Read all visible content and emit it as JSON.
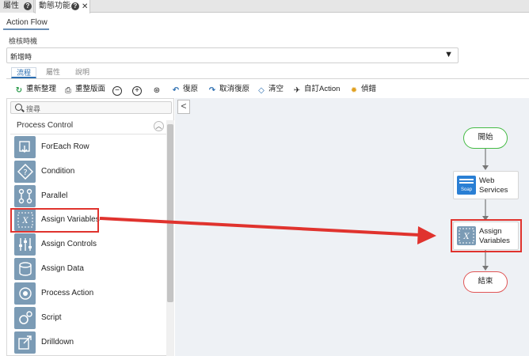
{
  "top_tabs": [
    {
      "label": "屬性"
    },
    {
      "label": "動態功能"
    }
  ],
  "panel": {
    "title": "Action Flow",
    "field_label": "檢核時機",
    "select_value": "新增時"
  },
  "sub_tabs": [
    {
      "label": "流程",
      "active": true
    },
    {
      "label": "屬性"
    },
    {
      "label": "說明"
    }
  ],
  "toolbar": [
    {
      "icon": "refresh-icon",
      "label": "重新整理"
    },
    {
      "icon": "reset-panel-icon",
      "label": "重整版面"
    },
    {
      "icon": "zoom-out-icon",
      "label": "⊖"
    },
    {
      "icon": "zoom-in-icon",
      "label": "⊕"
    },
    {
      "icon": "fit-icon",
      "label": "⊙"
    },
    {
      "icon": "undo-icon",
      "label": "復原"
    },
    {
      "icon": "redo-icon",
      "label": "取消復原"
    },
    {
      "icon": "eraser-icon",
      "label": "清空"
    },
    {
      "icon": "custom-action-icon",
      "label": "自訂Action"
    },
    {
      "icon": "debug-icon",
      "label": "偵錯"
    }
  ],
  "palette": {
    "search_placeholder": "搜尋",
    "group_title": "Process Control",
    "group_toggle": "^",
    "items": [
      {
        "label": "ForEach Row",
        "icon": "foreach-icon"
      },
      {
        "label": "Condition",
        "icon": "condition-icon"
      },
      {
        "label": "Parallel",
        "icon": "parallel-icon"
      },
      {
        "label": "Assign Variables",
        "icon": "assign-variables-icon"
      },
      {
        "label": "Assign Controls",
        "icon": "assign-controls-icon"
      },
      {
        "label": "Assign Data",
        "icon": "assign-data-icon"
      },
      {
        "label": "Process Action",
        "icon": "process-action-icon"
      },
      {
        "label": "Script",
        "icon": "script-icon"
      },
      {
        "label": "Drilldown",
        "icon": "drilldown-icon"
      }
    ]
  },
  "flow": {
    "start": "開始",
    "nodes": [
      {
        "label_line1": "Web",
        "label_line2": "Services",
        "icon": "soap-icon",
        "icon_text": "Soap"
      },
      {
        "label_line1": "Assign",
        "label_line2": "Variables",
        "icon": "assign-variables-icon"
      }
    ],
    "end": "結束"
  },
  "colors": {
    "accent": "#2a6db0",
    "highlight": "#e0332e",
    "node_icon": "#7b9bb5",
    "start_border": "#44bb44",
    "end_border": "#e05555"
  }
}
